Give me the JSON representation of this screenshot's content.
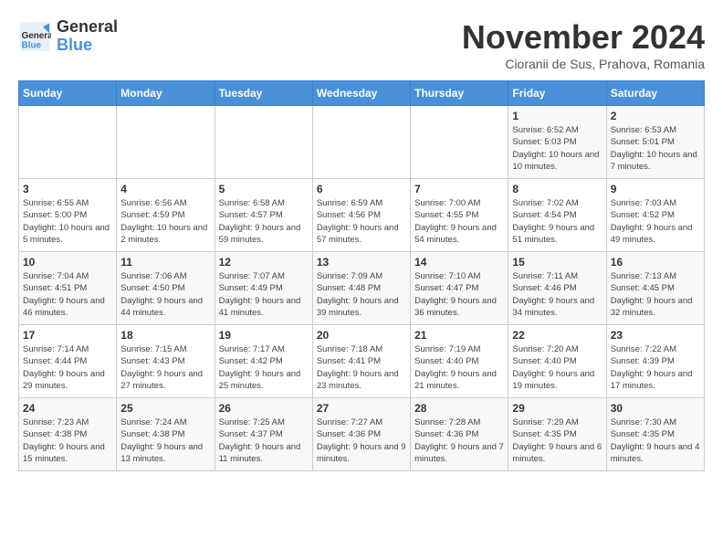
{
  "logo": {
    "text_general": "General",
    "text_blue": "Blue"
  },
  "header": {
    "month": "November 2024",
    "location": "Cioranii de Sus, Prahova, Romania"
  },
  "weekdays": [
    "Sunday",
    "Monday",
    "Tuesday",
    "Wednesday",
    "Thursday",
    "Friday",
    "Saturday"
  ],
  "weeks": [
    [
      {
        "day": "",
        "info": ""
      },
      {
        "day": "",
        "info": ""
      },
      {
        "day": "",
        "info": ""
      },
      {
        "day": "",
        "info": ""
      },
      {
        "day": "",
        "info": ""
      },
      {
        "day": "1",
        "info": "Sunrise: 6:52 AM\nSunset: 5:03 PM\nDaylight: 10 hours and 10 minutes."
      },
      {
        "day": "2",
        "info": "Sunrise: 6:53 AM\nSunset: 5:01 PM\nDaylight: 10 hours and 7 minutes."
      }
    ],
    [
      {
        "day": "3",
        "info": "Sunrise: 6:55 AM\nSunset: 5:00 PM\nDaylight: 10 hours and 5 minutes."
      },
      {
        "day": "4",
        "info": "Sunrise: 6:56 AM\nSunset: 4:59 PM\nDaylight: 10 hours and 2 minutes."
      },
      {
        "day": "5",
        "info": "Sunrise: 6:58 AM\nSunset: 4:57 PM\nDaylight: 9 hours and 59 minutes."
      },
      {
        "day": "6",
        "info": "Sunrise: 6:59 AM\nSunset: 4:56 PM\nDaylight: 9 hours and 57 minutes."
      },
      {
        "day": "7",
        "info": "Sunrise: 7:00 AM\nSunset: 4:55 PM\nDaylight: 9 hours and 54 minutes."
      },
      {
        "day": "8",
        "info": "Sunrise: 7:02 AM\nSunset: 4:54 PM\nDaylight: 9 hours and 51 minutes."
      },
      {
        "day": "9",
        "info": "Sunrise: 7:03 AM\nSunset: 4:52 PM\nDaylight: 9 hours and 49 minutes."
      }
    ],
    [
      {
        "day": "10",
        "info": "Sunrise: 7:04 AM\nSunset: 4:51 PM\nDaylight: 9 hours and 46 minutes."
      },
      {
        "day": "11",
        "info": "Sunrise: 7:06 AM\nSunset: 4:50 PM\nDaylight: 9 hours and 44 minutes."
      },
      {
        "day": "12",
        "info": "Sunrise: 7:07 AM\nSunset: 4:49 PM\nDaylight: 9 hours and 41 minutes."
      },
      {
        "day": "13",
        "info": "Sunrise: 7:09 AM\nSunset: 4:48 PM\nDaylight: 9 hours and 39 minutes."
      },
      {
        "day": "14",
        "info": "Sunrise: 7:10 AM\nSunset: 4:47 PM\nDaylight: 9 hours and 36 minutes."
      },
      {
        "day": "15",
        "info": "Sunrise: 7:11 AM\nSunset: 4:46 PM\nDaylight: 9 hours and 34 minutes."
      },
      {
        "day": "16",
        "info": "Sunrise: 7:13 AM\nSunset: 4:45 PM\nDaylight: 9 hours and 32 minutes."
      }
    ],
    [
      {
        "day": "17",
        "info": "Sunrise: 7:14 AM\nSunset: 4:44 PM\nDaylight: 9 hours and 29 minutes."
      },
      {
        "day": "18",
        "info": "Sunrise: 7:15 AM\nSunset: 4:43 PM\nDaylight: 9 hours and 27 minutes."
      },
      {
        "day": "19",
        "info": "Sunrise: 7:17 AM\nSunset: 4:42 PM\nDaylight: 9 hours and 25 minutes."
      },
      {
        "day": "20",
        "info": "Sunrise: 7:18 AM\nSunset: 4:41 PM\nDaylight: 9 hours and 23 minutes."
      },
      {
        "day": "21",
        "info": "Sunrise: 7:19 AM\nSunset: 4:40 PM\nDaylight: 9 hours and 21 minutes."
      },
      {
        "day": "22",
        "info": "Sunrise: 7:20 AM\nSunset: 4:40 PM\nDaylight: 9 hours and 19 minutes."
      },
      {
        "day": "23",
        "info": "Sunrise: 7:22 AM\nSunset: 4:39 PM\nDaylight: 9 hours and 17 minutes."
      }
    ],
    [
      {
        "day": "24",
        "info": "Sunrise: 7:23 AM\nSunset: 4:38 PM\nDaylight: 9 hours and 15 minutes."
      },
      {
        "day": "25",
        "info": "Sunrise: 7:24 AM\nSunset: 4:38 PM\nDaylight: 9 hours and 13 minutes."
      },
      {
        "day": "26",
        "info": "Sunrise: 7:25 AM\nSunset: 4:37 PM\nDaylight: 9 hours and 11 minutes."
      },
      {
        "day": "27",
        "info": "Sunrise: 7:27 AM\nSunset: 4:36 PM\nDaylight: 9 hours and 9 minutes."
      },
      {
        "day": "28",
        "info": "Sunrise: 7:28 AM\nSunset: 4:36 PM\nDaylight: 9 hours and 7 minutes."
      },
      {
        "day": "29",
        "info": "Sunrise: 7:29 AM\nSunset: 4:35 PM\nDaylight: 9 hours and 6 minutes."
      },
      {
        "day": "30",
        "info": "Sunrise: 7:30 AM\nSunset: 4:35 PM\nDaylight: 9 hours and 4 minutes."
      }
    ]
  ]
}
